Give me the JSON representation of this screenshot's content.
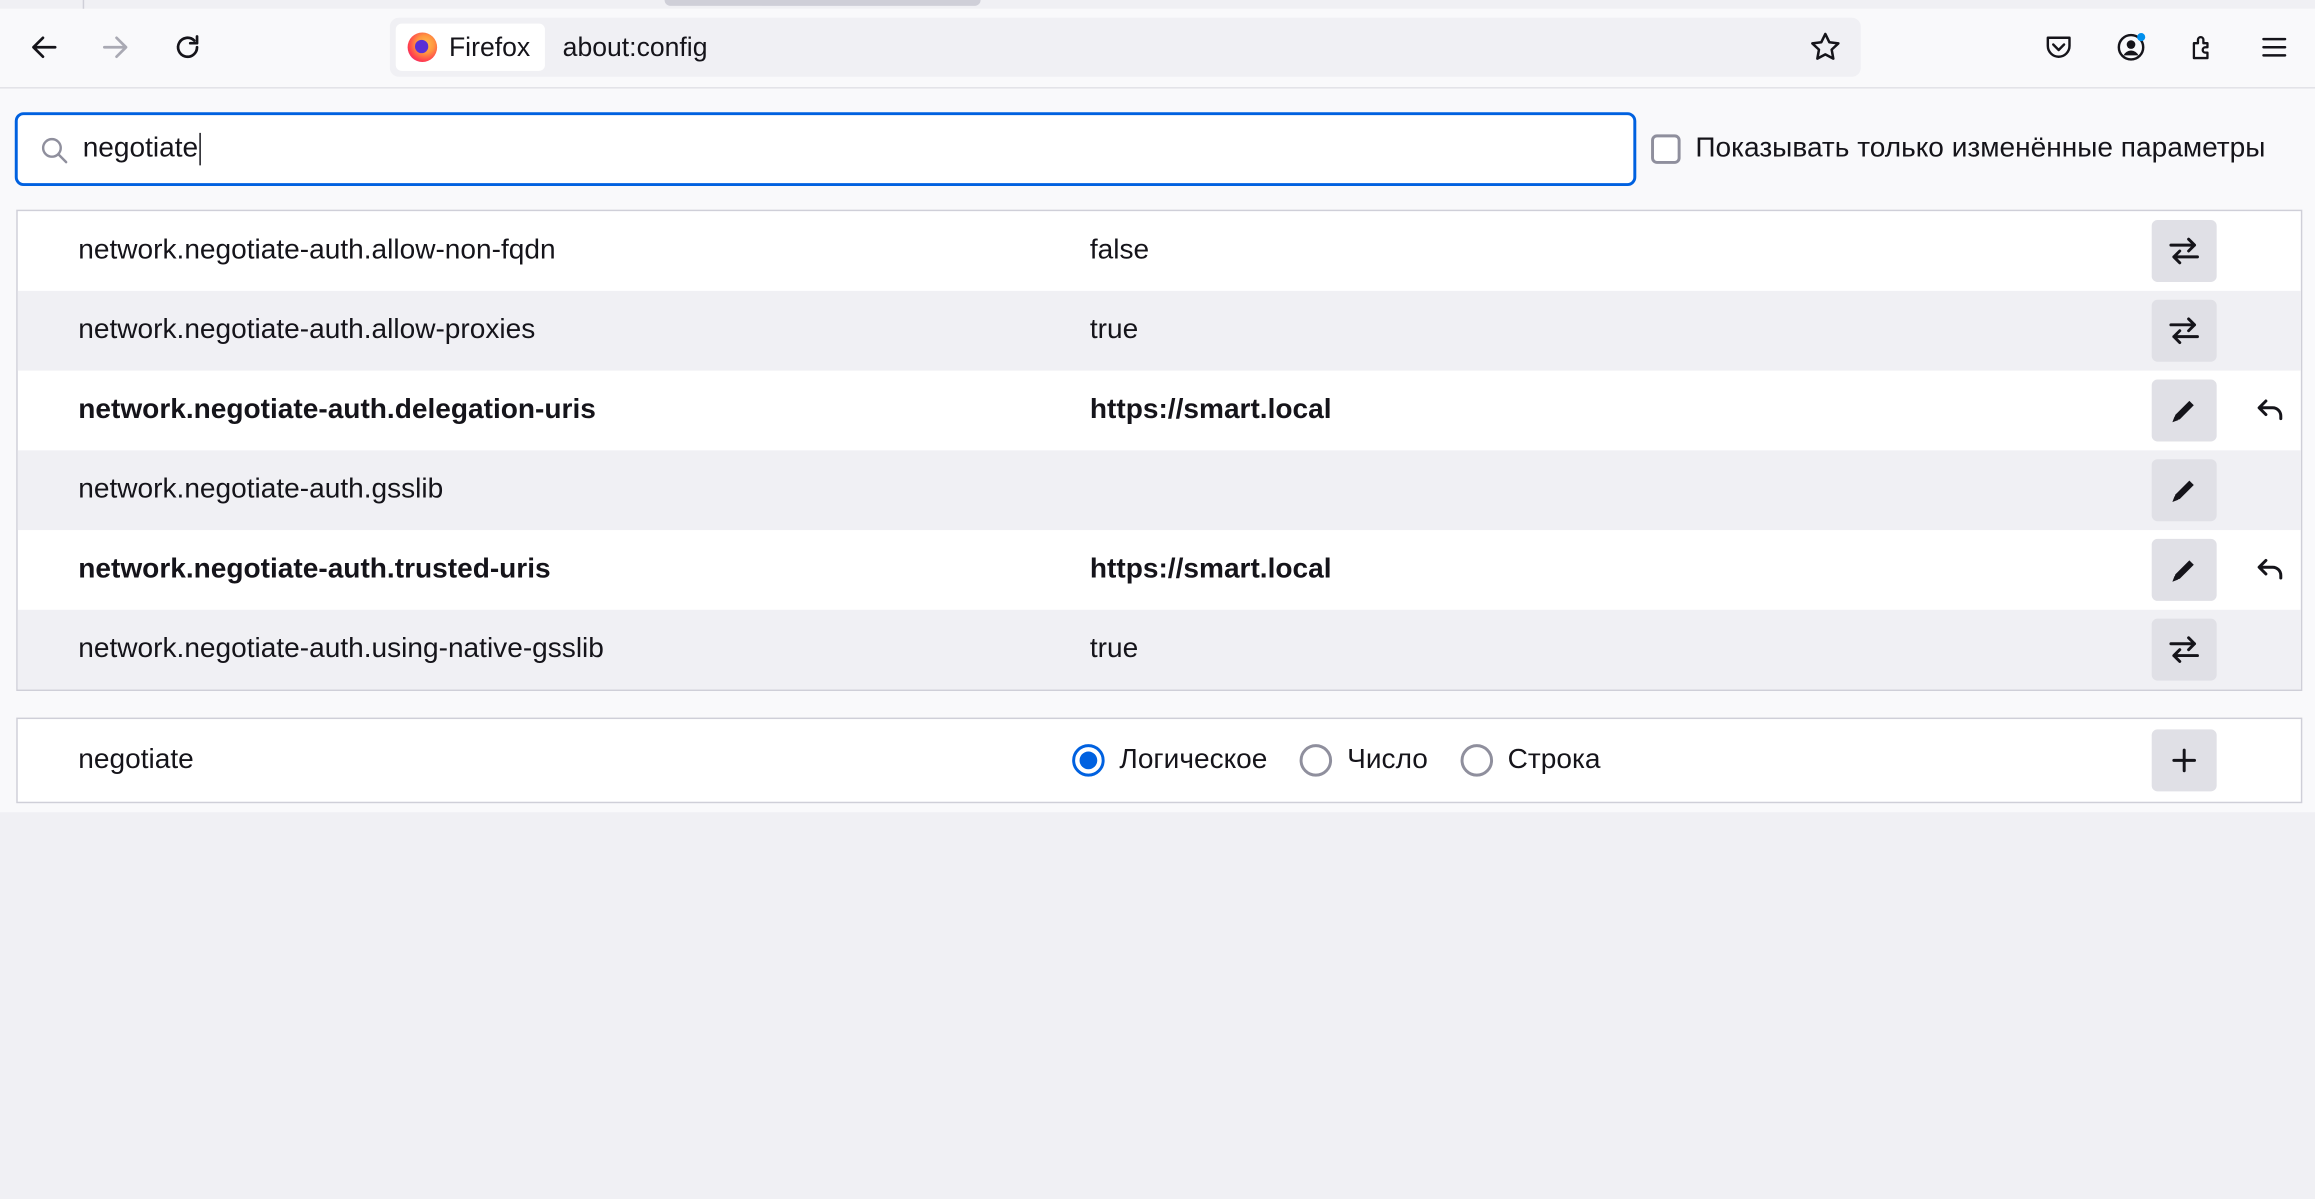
{
  "browser": {
    "identity_label": "Firefox",
    "url": "about:config"
  },
  "toolbar": {
    "back_icon": "back-arrow-icon",
    "forward_icon": "forward-arrow-icon",
    "reload_icon": "reload-icon",
    "bookmark_icon": "star-icon",
    "pocket_icon": "pocket-icon",
    "account_icon": "account-icon",
    "extensions_icon": "extensions-icon",
    "menu_icon": "hamburger-menu-icon"
  },
  "search": {
    "value": "negotiate",
    "modified_only_label": "Показывать только изменённые параметры",
    "modified_only_checked": false
  },
  "prefs": [
    {
      "name": "network.negotiate-auth.allow-non-fqdn",
      "value": "false",
      "modified": false,
      "action": "toggle"
    },
    {
      "name": "network.negotiate-auth.allow-proxies",
      "value": "true",
      "modified": false,
      "action": "toggle"
    },
    {
      "name": "network.negotiate-auth.delegation-uris",
      "value": "https://smart.local",
      "modified": true,
      "action": "edit"
    },
    {
      "name": "network.negotiate-auth.gsslib",
      "value": "",
      "modified": false,
      "action": "edit"
    },
    {
      "name": "network.negotiate-auth.trusted-uris",
      "value": "https://smart.local",
      "modified": true,
      "action": "edit"
    },
    {
      "name": "network.negotiate-auth.using-native-gsslib",
      "value": "true",
      "modified": false,
      "action": "toggle"
    }
  ],
  "add_pref": {
    "name": "negotiate",
    "types": [
      {
        "label": "Логическое",
        "checked": true
      },
      {
        "label": "Число",
        "checked": false
      },
      {
        "label": "Строка",
        "checked": false
      }
    ]
  },
  "colors": {
    "accent": "#0061e0",
    "row_alt": "#f0f0f4",
    "button_bg": "#e0e0e6"
  }
}
